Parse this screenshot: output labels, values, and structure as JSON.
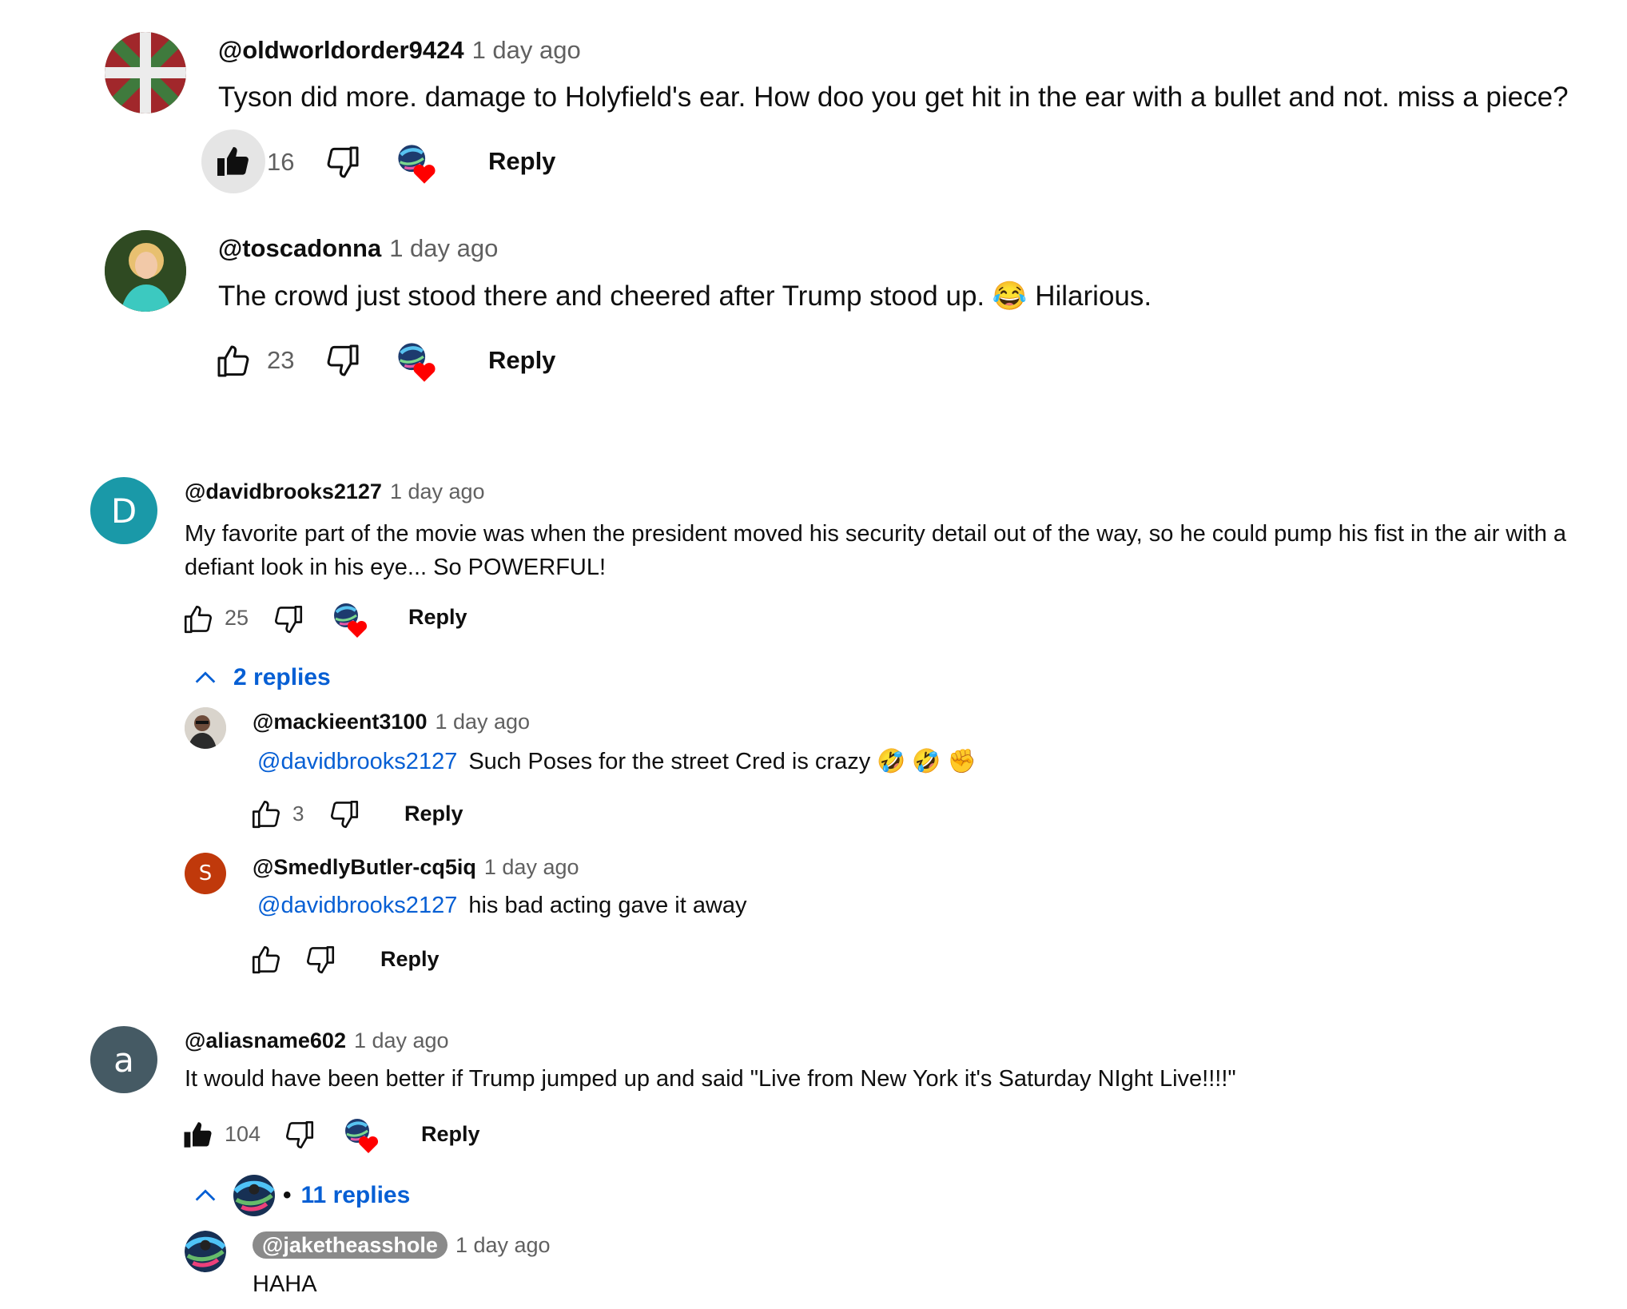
{
  "comments": [
    {
      "handle": "@oldworldorder9424",
      "time": "1 day ago",
      "text": "Tyson did more. damage to Holyfield's ear. How doo you get hit in the ear with a bullet and not. miss a piece?",
      "likes": "16",
      "liked": true,
      "creator_heart": true,
      "reply_label": "Reply",
      "avatar_icon": "basque-flag-avatar"
    },
    {
      "handle": "@toscadonna",
      "time": "1 day ago",
      "text_before": "The crowd just stood there and cheered after Trump stood up.",
      "emoji": "😂",
      "text_after": "Hilarious.",
      "likes": "23",
      "liked": false,
      "creator_heart": true,
      "reply_label": "Reply",
      "avatar_icon": "photo-avatar"
    },
    {
      "handle": "@davidbrooks2127",
      "time": "1 day ago",
      "text": "My favorite part of the movie was when the president moved his security detail out of the way, so he could pump his fist in the air with a defiant look in his eye... So POWERFUL!",
      "likes": "25",
      "liked": false,
      "creator_heart": true,
      "reply_label": "Reply",
      "avatar_letter": "D",
      "avatar_color": "#1a99a8",
      "replies_label": "2 replies",
      "replies": [
        {
          "handle": "@mackieent3100",
          "time": "1 day ago",
          "mention": "@davidbrooks2127",
          "text": "Such Poses for the street Cred is crazy",
          "emojis": "🤣 🤣 ✊",
          "likes": "3",
          "reply_label": "Reply",
          "avatar_icon": "photo-avatar"
        },
        {
          "handle": "@SmedlyButler-cq5iq",
          "time": "1 day ago",
          "mention": "@davidbrooks2127",
          "text": "his bad acting gave it away",
          "likes": "",
          "reply_label": "Reply",
          "avatar_letter": "S",
          "avatar_color": "#c0390b"
        }
      ]
    },
    {
      "handle": "@aliasname602",
      "time": "1 day ago",
      "text": "It would have been better if Trump jumped up and said \"Live from New York it's Saturday NIght Live!!!!\"",
      "likes": "104",
      "liked": true,
      "creator_heart": true,
      "reply_label": "Reply",
      "avatar_letter": "a",
      "avatar_color": "#455a64",
      "replies_label": "11 replies",
      "replies_separator": "•",
      "replies": [
        {
          "handle": "@jaketheasshole",
          "time": "1 day ago",
          "text": "HAHA",
          "is_creator": true,
          "avatar_icon": "creator-avatar"
        }
      ]
    }
  ],
  "colors": {
    "link_blue": "#065fd4",
    "meta_gray": "#606060",
    "heart_red": "#ff0000",
    "creator_chip": "#8a8a8a"
  }
}
